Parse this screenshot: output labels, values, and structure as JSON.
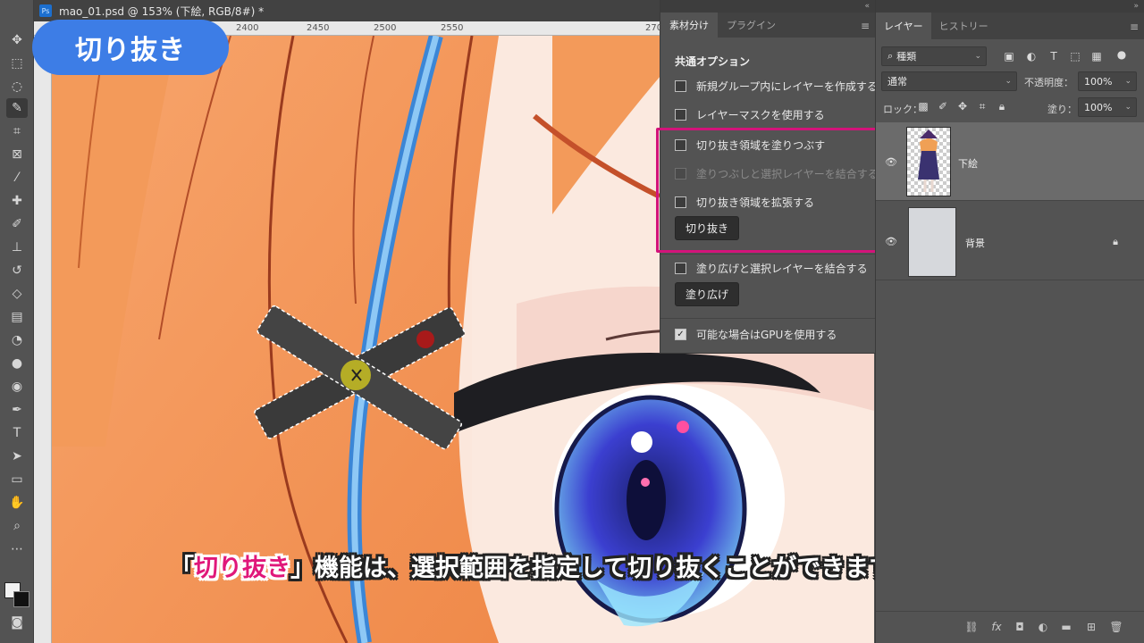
{
  "document": {
    "title": "mao_01.psd @ 153% (下絵, RGB/8#) *",
    "ps_glyph": "Ps",
    "ruler_ticks": [
      "2400",
      "2450",
      "2500",
      "2550",
      "270"
    ]
  },
  "overlay": {
    "badge": "切り抜き",
    "subtitle_open": "「",
    "subtitle_highlight": "切り抜き",
    "subtitle_rest": "」機能は、選択範囲を指定して切り抜くことができます。"
  },
  "plugin_panel": {
    "tabs": [
      {
        "label": "素材分け"
      },
      {
        "label": "プラグイン"
      }
    ],
    "section_title": "共通オプション",
    "options": [
      {
        "label": "新規グループ内にレイヤーを作成する",
        "checked": false,
        "disabled": false
      },
      {
        "label": "レイヤーマスクを使用する",
        "checked": false,
        "disabled": false
      },
      {
        "label": "切り抜き領域を塗りつぶす",
        "checked": false,
        "disabled": false
      },
      {
        "label": "塗りつぶしと選択レイヤーを結合する",
        "checked": false,
        "disabled": true
      },
      {
        "label": "切り抜き領域を拡張する",
        "checked": false,
        "disabled": false
      },
      {
        "label": "塗り広げと選択レイヤーを結合する",
        "checked": false,
        "disabled": false
      },
      {
        "label": "可能な場合はGPUを使用する",
        "checked": true,
        "disabled": false
      }
    ],
    "crop_button": "切り抜き",
    "spread_button": "塗り広げ",
    "highlight_color": "#d3137a"
  },
  "layers_panel": {
    "tabs": [
      {
        "label": "レイヤー"
      },
      {
        "label": "ヒストリー"
      }
    ],
    "filter_kind": "種類",
    "blend_mode": "通常",
    "opacity_label": "不透明度：",
    "opacity_value": "100%",
    "lock_label": "ロック：",
    "fill_label": "塗り：",
    "fill_value": "100%",
    "layers": [
      {
        "name": "下絵",
        "selected": true,
        "locked": false
      },
      {
        "name": "背景",
        "selected": false,
        "locked": true
      }
    ]
  },
  "colors": {
    "accent": "#3d7de6",
    "highlight": "#e0177a"
  }
}
